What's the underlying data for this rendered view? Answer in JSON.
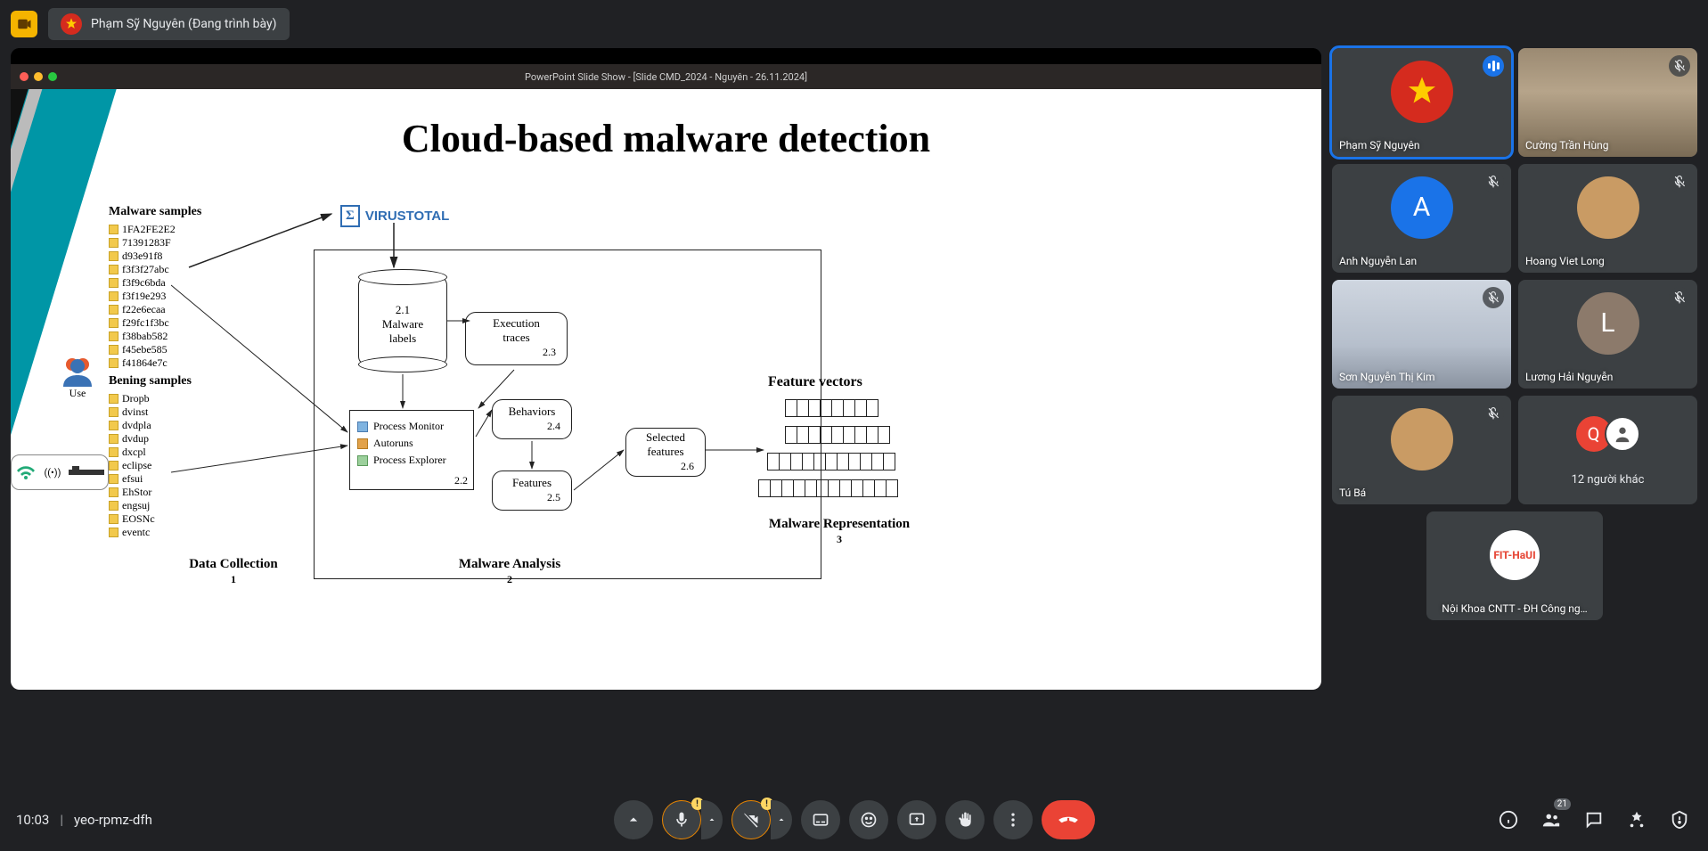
{
  "header": {
    "presenter_name": "Phạm Sỹ Nguyên (Đang trình bày)"
  },
  "slide": {
    "window_title": "PowerPoint Slide Show - [Slide CMD_2024 - Nguyên - 26.11.2024]",
    "title": "Cloud-based malware detection",
    "malware_header": "Malware samples",
    "malware_files": [
      "1FA2FE2E2",
      "71391283F",
      "d93e91f8",
      "f3f3f27abc",
      "f3f9c6bda",
      "f3f19e293",
      "f22e6ecaa",
      "f29fc1f3bc",
      "f38bab582",
      "f45ebe585",
      "f41864e7c"
    ],
    "benign_header": "Bening samples",
    "benign_files": [
      "Dropb",
      "dvinst",
      "dvdpla",
      "dvdup",
      "dxcpl",
      "eclipse",
      "efsui",
      "EhStor",
      "engsuj",
      "EOSNc",
      "eventc"
    ],
    "vt": "VIRUSTOTAL",
    "box_2_1_num": "2.1",
    "box_malware_labels": "Malware\nlabels",
    "box_2_3": "Execution\ntraces",
    "box_2_3_num": "2.3",
    "tools_header_num": "2.2",
    "tool_1": "Process Monitor",
    "tool_2": "Autoruns",
    "tool_3": "Process Explorer",
    "box_2_4": "Behaviors",
    "box_2_4_num": "2.4",
    "box_2_5": "Features",
    "box_2_5_num": "2.5",
    "box_2_6": "Selected\nfeatures",
    "box_2_6_num": "2.6",
    "feature_vectors": "Feature vectors",
    "sec1": "Data Collection",
    "sec1n": "1",
    "sec2": "Malware Analysis",
    "sec2n": "2",
    "sec3": "Malware Representation",
    "sec3n": "3",
    "user_label": "Use"
  },
  "participants": [
    {
      "name": "Phạm Sỹ Nguyên",
      "type": "star",
      "color": "#d52b1e",
      "speaking": true
    },
    {
      "name": "Cường Trần Hùng",
      "type": "cam",
      "muted": true,
      "bg": "cam1"
    },
    {
      "name": "Anh Nguyễn Lan",
      "type": "letter",
      "letter": "A",
      "color": "#1a73e8",
      "muted": true
    },
    {
      "name": "Hoang Viet Long",
      "type": "img",
      "muted": true
    },
    {
      "name": "Sơn Nguyễn Thị Kim",
      "type": "cam",
      "muted": true,
      "bg": "indoor"
    },
    {
      "name": "Lương Hải Nguyễn",
      "type": "letter",
      "letter": "L",
      "color": "#8c7a6b",
      "muted": true
    },
    {
      "name": "Tú Bá",
      "type": "img",
      "muted": true
    },
    {
      "name": "12 người khác",
      "type": "more",
      "extra": [
        "Q",
        ""
      ]
    }
  ],
  "roster_tile": {
    "name": "Nội Khoa CNTT - ĐH Công ng…"
  },
  "footer": {
    "time": "10:03",
    "code": "yeo-rpmz-dfh",
    "people_count": "21"
  }
}
